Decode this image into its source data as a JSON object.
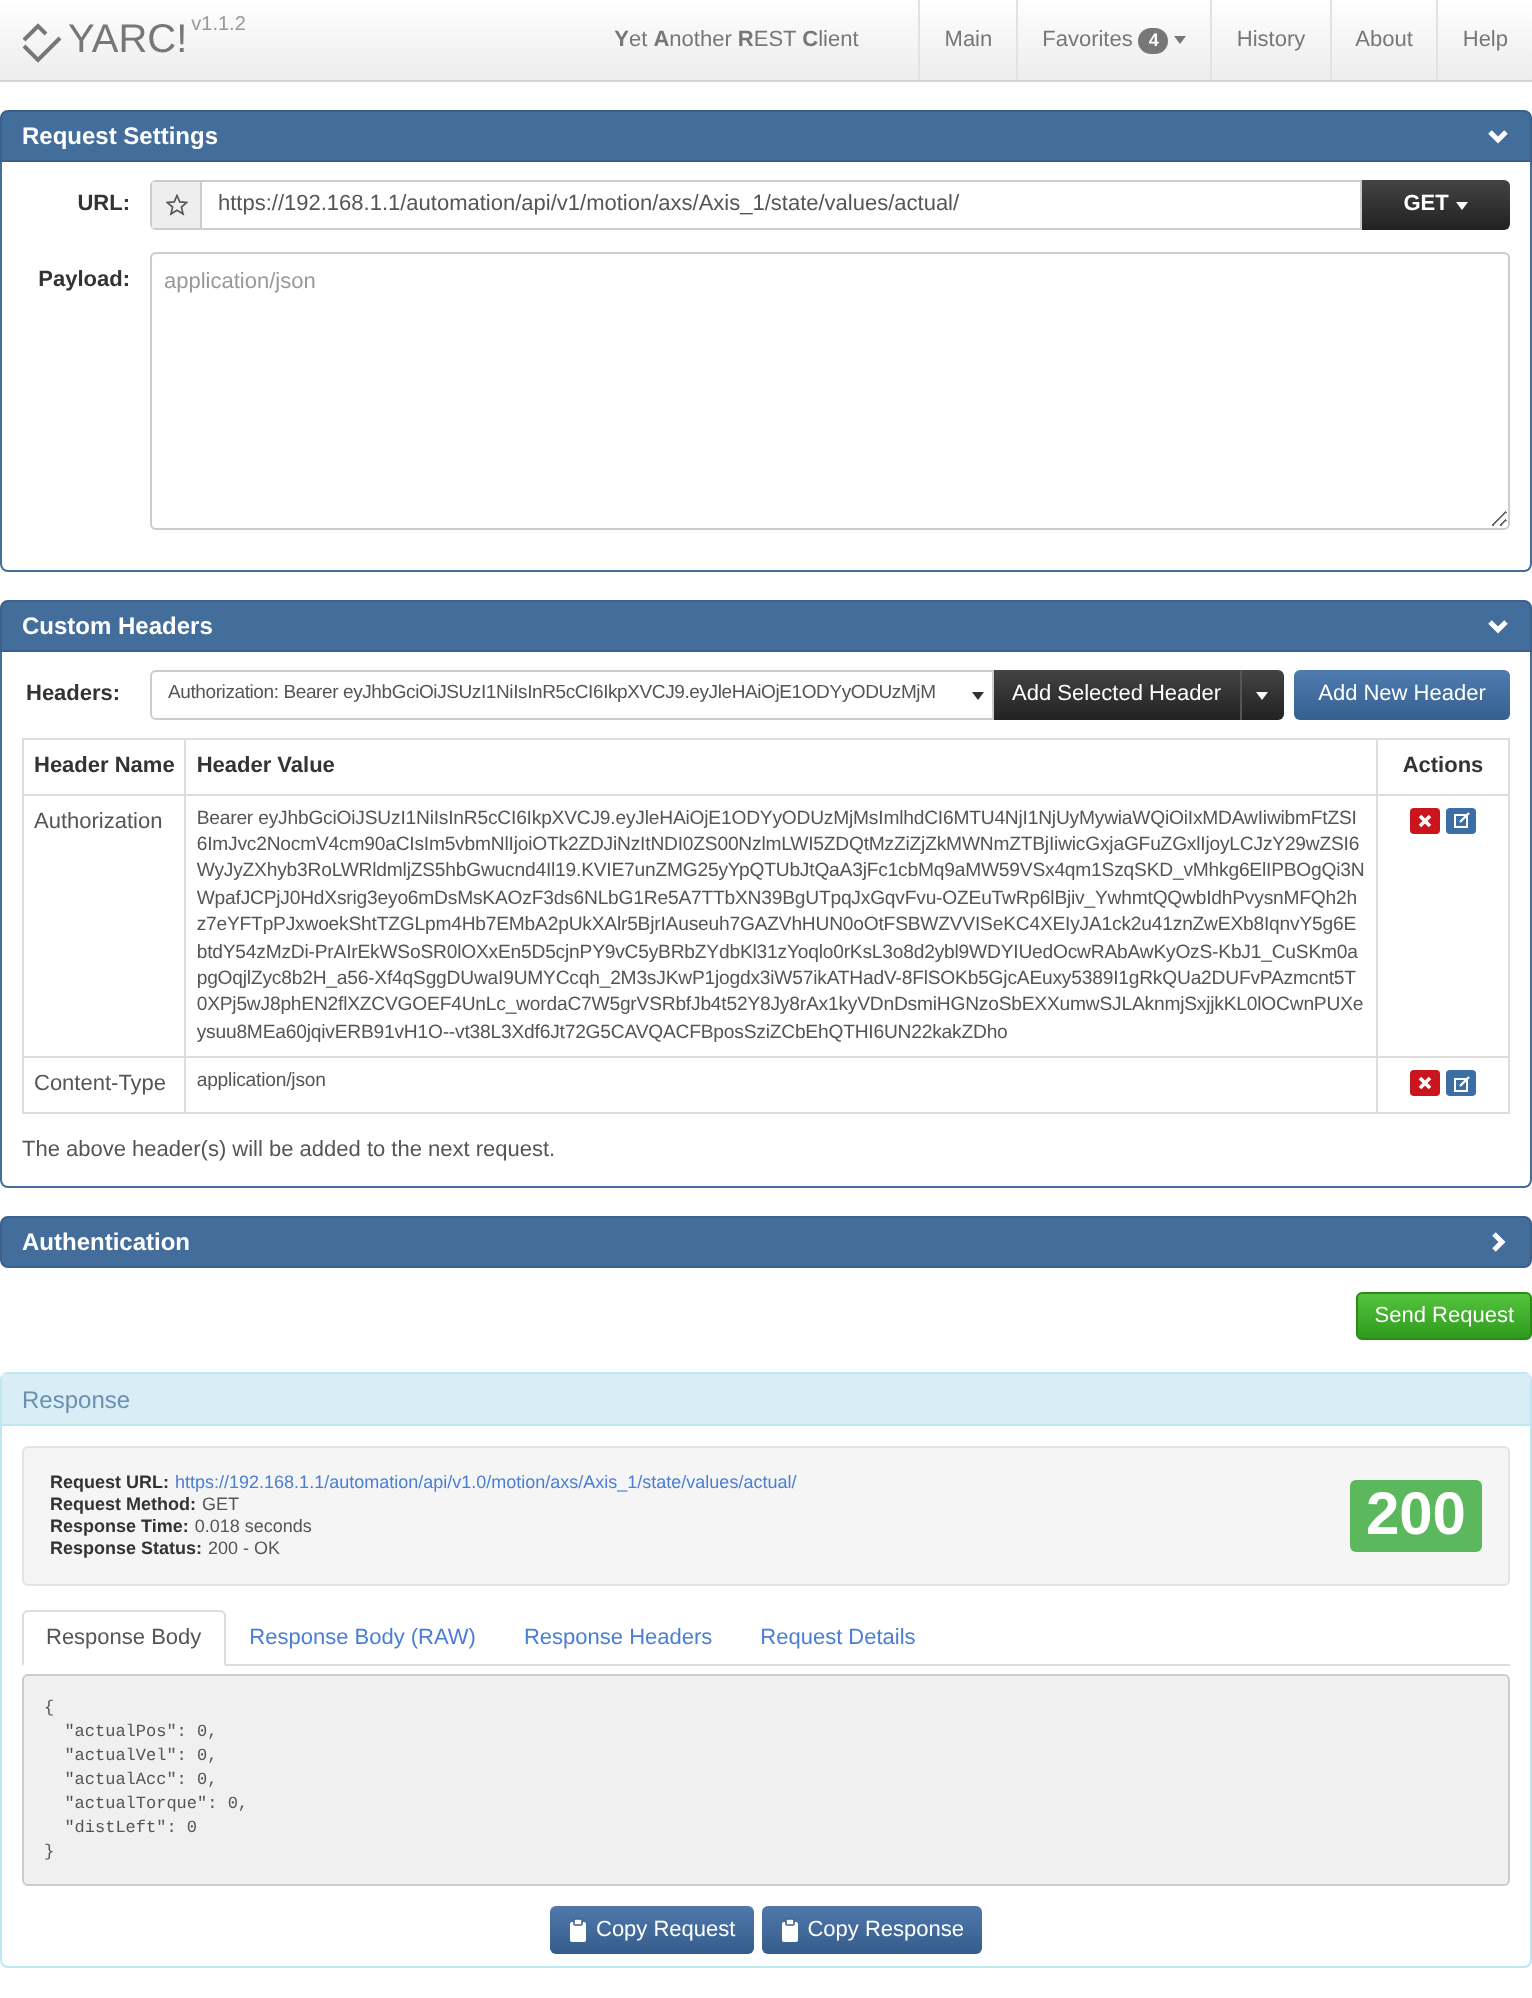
{
  "navbar": {
    "logo": "YARC!",
    "version": "v1.1.2",
    "tagline": "**Y**et **A**nother **R**EST **C**lient",
    "items": [
      {
        "label": "Main"
      },
      {
        "label": "Favorites",
        "badge": "4",
        "has_menu": true
      },
      {
        "label": "History"
      },
      {
        "label": "About"
      },
      {
        "label": "Help"
      }
    ]
  },
  "request_settings": {
    "title": "Request Settings",
    "expanded": true,
    "url_label": "URL:",
    "url": "https://192.168.1.1/automation/api/v1/motion/axs/Axis_1/state/values/actual/",
    "method": "GET",
    "payload_label": "Payload:",
    "payload_placeholder": "application/json"
  },
  "custom_headers": {
    "title": "Custom Headers",
    "expanded": true,
    "headers_label": "Headers:",
    "selected_header": "Authorization: Bearer eyJhbGciOiJSUzI1NiIsInR5cCI6IkpXVCJ9.eyJleHAiOjE1ODYyODUzMjM",
    "add_selected_label": "Add Selected Header",
    "add_new_label": "Add New Header",
    "columns": [
      "Header Name",
      "Header Value",
      "Actions"
    ],
    "rows": [
      {
        "name": "Authorization",
        "value": "Bearer eyJhbGciOiJSUzI1NiIsInR5cCI6IkpXVCJ9.eyJleHAiOjE1ODYyODUzMjMsImlhdCI6MTU4NjI1NjUyMywiaWQiOiIxMDAwIiwibmFtZSI6ImJvc2NocmV4cm90aCIsIm5vbmNlIjoiOTk2ZDJiNzItNDI0ZS00NzlmLWI5ZDQtMzZiZjZkMWNmZTBjIiwicGxjaGFuZGxlIjoyLCJzY29wZSI6WyJyZXhyb3RoLWRldmljZS5hbGwucnd4Il19.KVIE7unZMG25yYpQTUbJtQaA3jFc1cbMq9aMW59VSx4qm1SzqSKD_vMhkg6ElIPBOgQi3NWpafJCPjJ0HdXsrig3eyo6mDsMsKAOzF3ds6NLbG1Re5A7TTbXN39BgUTpqJxGqvFvu-OZEuTwRp6lBjiv_YwhmtQQwbIdhPvysnMFQh2hz7eYFTpPJxwoekShtTZGLpm4Hb7EMbA2pUkXAlr5BjrIAuseuh7GAZVhHUN0oOtFSBWZVVISeKC4XEIyJA1ck2u41znZwEXb8IqnvY5g6EbtdY54zMzDi-PrAIrEkWSoSR0lOXxEn5D5cjnPY9vC5yBRbZYdbKl31zYoqlo0rKsL3o8d2ybl9WDYIUedOcwRAbAwKyOzS-KbJ1_CuSKm0apgOqjlZyc8b2H_a56-Xf4qSggDUwaI9UMYCcqh_2M3sJKwP1jogdx3iW57ikATHadV-8FlSOKb5GjcAEuxy5389I1gRkQUa2DUFvPAzmcnt5T0XPj5wJ8phEN2flXZCVGOEF4UnLc_wordaC7W5grVSRbfJb4t52Y8Jy8rAx1kyVDnDsmiHGNzoSbEXXumwSJLAknmjSxjjkKL0lOCwnPUXeysuu8MEa60jqivERB91vH1O--vt38L3Xdf6Jt72G5CAVQACFBposSziZCbEhQTHI6UN22kakZDho"
      },
      {
        "name": "Content-Type",
        "value": "application/json"
      }
    ],
    "note": "The above header(s) will be added to the next request."
  },
  "authentication": {
    "title": "Authentication",
    "expanded": false
  },
  "send_label": "Send Request",
  "response": {
    "title": "Response",
    "fields": [
      {
        "label": "Request URL:",
        "value": "https://192.168.1.1/automation/api/v1.0/motion/axs/Axis_1/state/values/actual/",
        "kind": "link"
      },
      {
        "label": "Request Method:",
        "value": "GET",
        "kind": "text"
      },
      {
        "label": "Response Time:",
        "value": "0.018 seconds",
        "kind": "text"
      },
      {
        "label": "Response Status:",
        "value": "200 - OK",
        "kind": "text"
      }
    ],
    "status_code": "200",
    "tabs": [
      {
        "label": "Response Body",
        "selected": true
      },
      {
        "label": "Response Body (RAW)",
        "selected": false
      },
      {
        "label": "Response Headers",
        "selected": false
      },
      {
        "label": "Request Details",
        "selected": false
      }
    ],
    "body": "{\n  \"actualPos\": 0,\n  \"actualVel\": 0,\n  \"actualAcc\": 0,\n  \"actualTorque\": 0,\n  \"distLeft\": 0\n}",
    "buttons": [
      "Copy Request",
      "Copy Response"
    ]
  }
}
